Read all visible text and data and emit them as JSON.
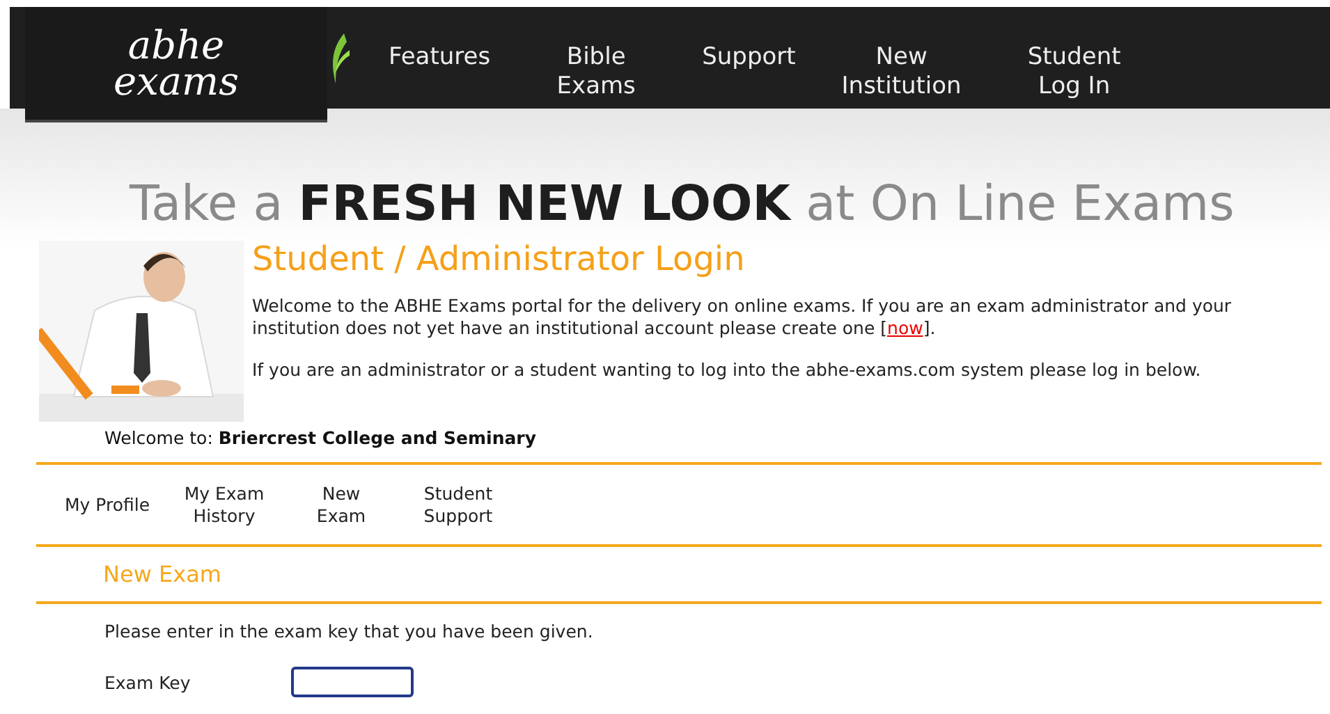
{
  "logo": "abhe exams",
  "nav": [
    "Features",
    "Bible Exams",
    "Support",
    "New Institution",
    "Student Log In"
  ],
  "headline": "Take a **FRESH NEW LOOK** at On Line Exams",
  "hero": {
    "kind": "picture"
  },
  "login_title": "Student / Administrator Login",
  "intro": {
    "before": "Welcome to the ABHE Exams portal for the delivery on online exams. If you are an exam administrator and your institution does not yet have an institutional account please create one [",
    "link": "now",
    "after": "]."
  },
  "login_note": "If you are an administrator or a student wanting to log into the abhe-exams.com system please log in below.",
  "welcome": "Welcome to: **Briercrest College and Seminary**",
  "tabs": [
    "My Profile",
    "My Exam History",
    "New Exam",
    "Student Support"
  ],
  "section_title": "New Exam",
  "instruction": "Please enter in the exam key that you have been given.",
  "exam_key": {
    "label": "Exam Key",
    "focused": true
  }
}
